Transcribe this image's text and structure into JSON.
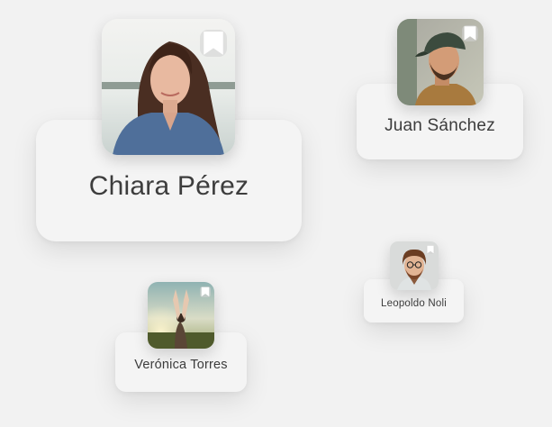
{
  "people": {
    "chiara": {
      "name": "Chiara Pérez",
      "photo_icon": "profile-photo-woman-long-hair",
      "bookmark_icon": "bookmark-icon"
    },
    "juan": {
      "name": "Juan Sánchez",
      "photo_icon": "profile-photo-man-cap",
      "bookmark_icon": "bookmark-icon"
    },
    "leopoldo": {
      "name": "Leopoldo Noli",
      "photo_icon": "profile-photo-man-glasses",
      "bookmark_icon": "bookmark-icon"
    },
    "veronica": {
      "name": "Verónica Torres",
      "photo_icon": "profile-photo-woman-arms-raised",
      "bookmark_icon": "bookmark-icon"
    }
  },
  "colors": {
    "background": "#f2f2f2",
    "card": "#f4f4f4",
    "text": "#3d3d3d"
  }
}
